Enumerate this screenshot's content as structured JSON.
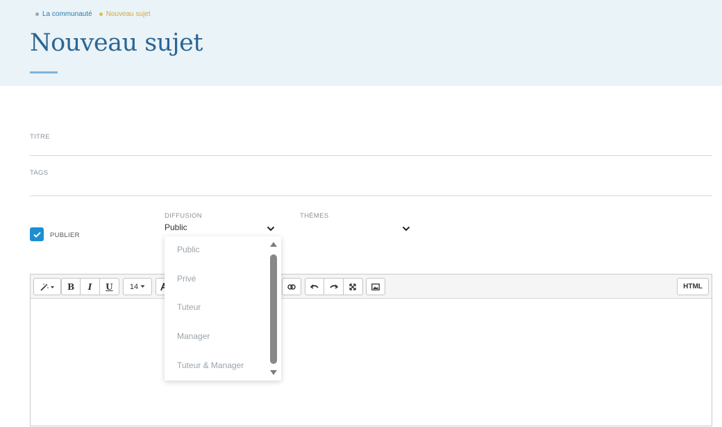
{
  "breadcrumb": {
    "items": [
      "La communauté",
      "Nouveau sujet"
    ]
  },
  "page": {
    "title": "Nouveau sujet"
  },
  "form": {
    "title_label": "TITRE",
    "title_value": "",
    "tags_label": "TAGS",
    "tags_value": "",
    "publish_label": "PUBLIER",
    "publish_checked": true,
    "diffusion_label": "DIFFUSION",
    "diffusion_value": "Public",
    "themes_label": "THÈMES",
    "themes_value": ""
  },
  "dropdown": {
    "options": [
      "Public",
      "Privé",
      "Tuteur",
      "Manager",
      "Tuteur & Manager"
    ]
  },
  "editor": {
    "font_size": "14",
    "html_label": "HTML",
    "content": ""
  },
  "colors": {
    "header_bg": "#eaf3f7",
    "title_color": "#2b6593",
    "accent": "#1d8fd0",
    "breadcrumb_link": "#2a7fb0",
    "breadcrumb_active": "#d6a93a"
  }
}
